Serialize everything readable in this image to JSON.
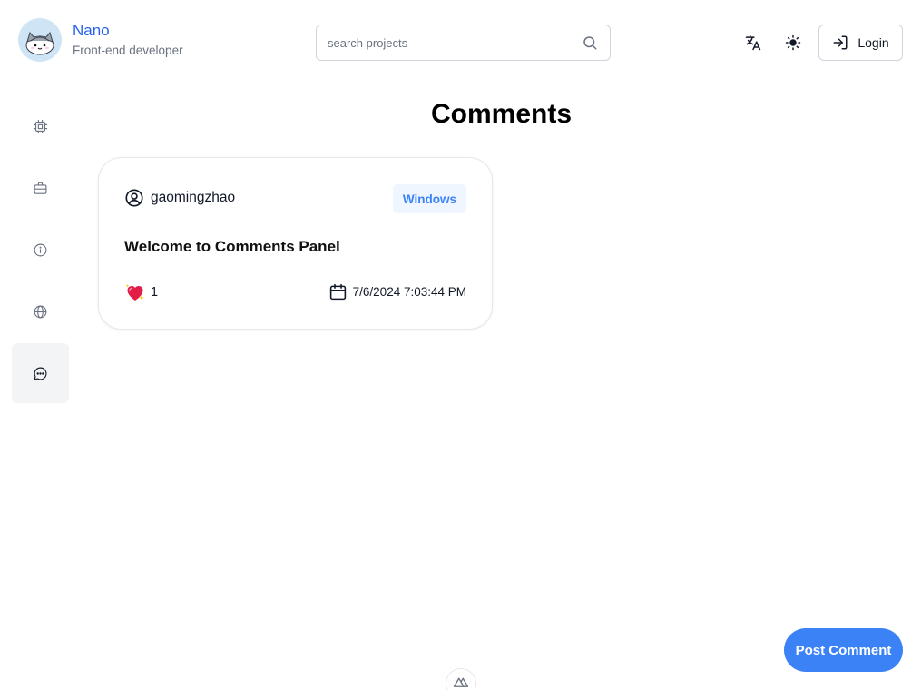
{
  "header": {
    "brand_name": "Nano",
    "brand_subtitle": "Front-end developer",
    "search_placeholder": "search projects",
    "login_label": "Login"
  },
  "sidebar": {
    "items": [
      {
        "icon": "cpu-chip-icon",
        "active": false
      },
      {
        "icon": "briefcase-icon",
        "active": false
      },
      {
        "icon": "info-icon",
        "active": false
      },
      {
        "icon": "globe-icon",
        "active": false
      },
      {
        "icon": "chat-bubble-icon",
        "active": true
      }
    ]
  },
  "main": {
    "title": "Comments",
    "comments": [
      {
        "user": "gaomingzhao",
        "tag": "Windows",
        "title": "Welcome to Comments Panel",
        "likes": "1",
        "date": "7/6/2024 7:03:44 PM"
      }
    ]
  },
  "actions": {
    "post_comment_label": "Post Comment"
  },
  "colors": {
    "accent": "#3b82f6",
    "brand_text": "#2563eb",
    "badge_bg": "#eff6ff"
  }
}
